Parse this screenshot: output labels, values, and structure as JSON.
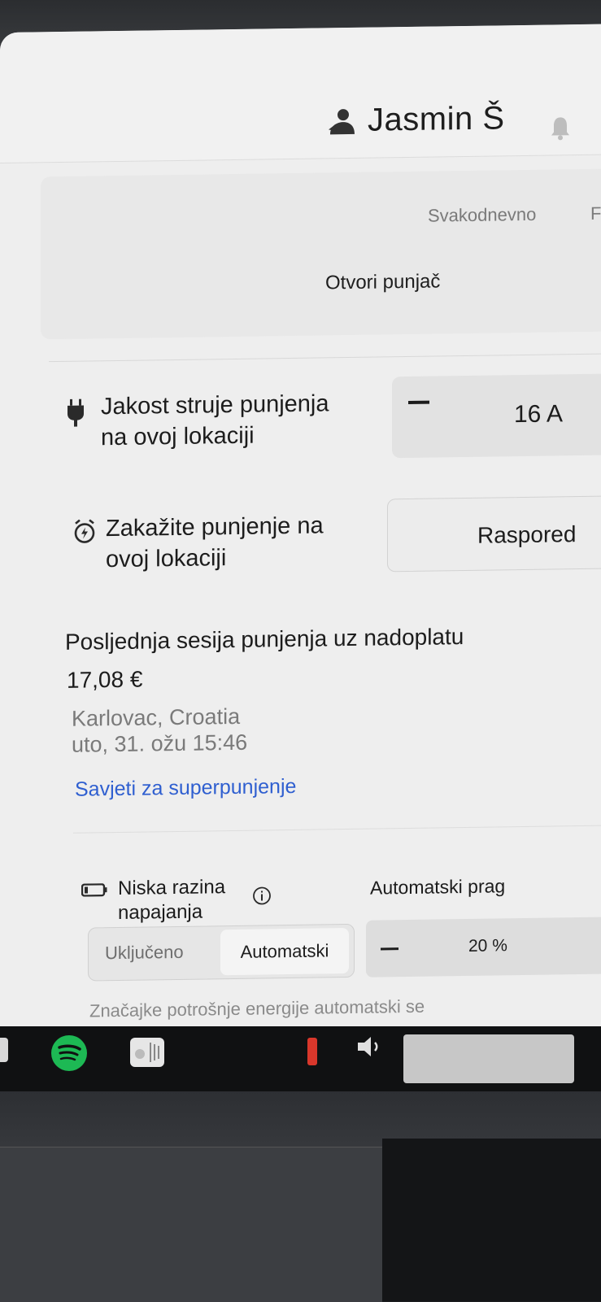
{
  "header": {
    "user_name": "Jasmin Š"
  },
  "schedule_tabs": {
    "daily": "Svakodnevno",
    "next": "F"
  },
  "open_charger_label": "Otvori punjač",
  "charge_current": {
    "label_line1": "Jakost struje punjenja",
    "label_line2": "na ovoj lokaciji",
    "value": "16 A"
  },
  "schedule_charging": {
    "label_line1": "Zakažite punjenje na",
    "label_line2": "ovoj lokaciji",
    "button_label": "Raspored"
  },
  "last_session": {
    "title": "Posljednja sesija punjenja uz nadoplatu",
    "price": "17,08 €",
    "location": "Karlovac, Croatia",
    "datetime": "uto, 31. ožu 15:46",
    "tips_link": "Savjeti za superpunjenje"
  },
  "low_power": {
    "label_line1": "Niska razina",
    "label_line2": "napajanja",
    "auto_threshold_label": "Automatski prag",
    "options": [
      "Uključeno",
      "Automatski"
    ],
    "selected": "Automatski",
    "threshold_value": "20 %",
    "footer": "Značajke potrošnje energije automatski se"
  },
  "colors": {
    "link": "#2f5fd0",
    "spotify": "#1db954",
    "screen_bg": "#eeeeee"
  },
  "taskbar_icons": [
    "spotify-icon",
    "radio-icon",
    "status-indicator-icon",
    "volume-icon"
  ]
}
